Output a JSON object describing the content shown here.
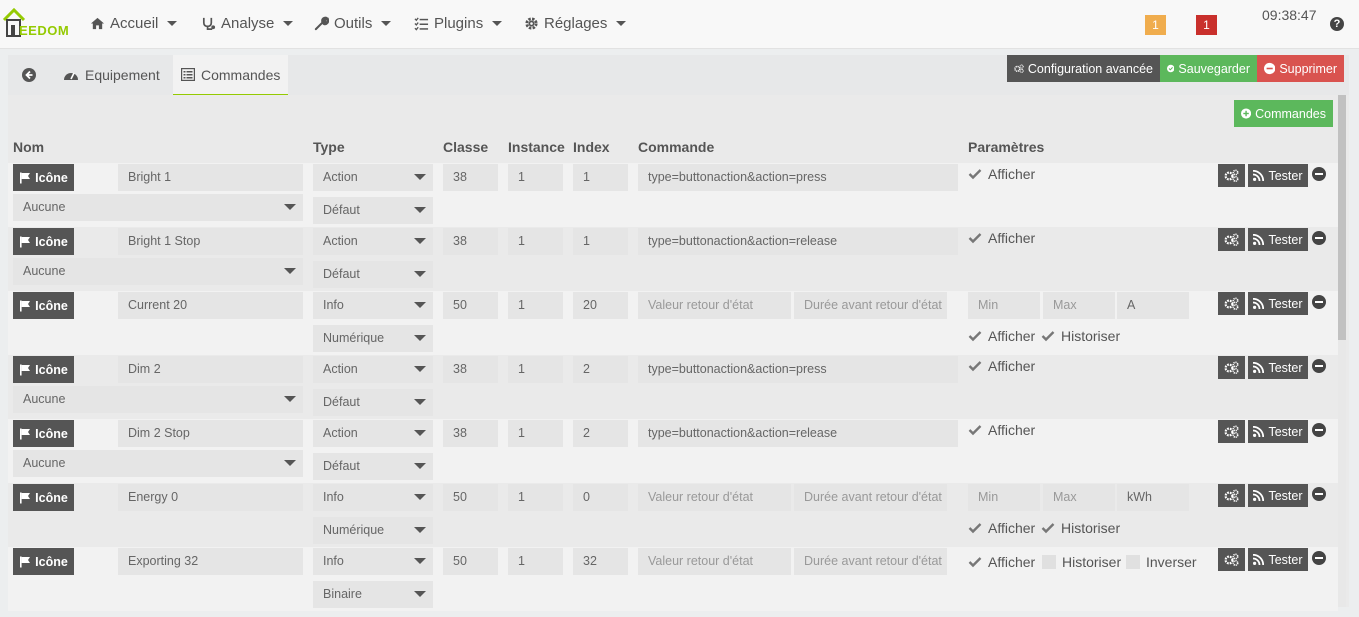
{
  "nav": {
    "logo_text": "EEDOM",
    "items": [
      {
        "label": "Accueil",
        "icon": "home-icon"
      },
      {
        "label": "Analyse",
        "icon": "stethoscope-icon"
      },
      {
        "label": "Outils",
        "icon": "wrench-icon"
      },
      {
        "label": "Plugins",
        "icon": "tasks-icon"
      },
      {
        "label": "Réglages",
        "icon": "cogs-icon"
      }
    ],
    "badge_warning": "1",
    "badge_danger": "1",
    "clock": "09:38:47",
    "help": "?"
  },
  "tabs": {
    "back_icon": "arrow-circle-left-icon",
    "equipement": "Equipement",
    "commandes": "Commandes"
  },
  "actions": {
    "config": "Configuration avancée",
    "save": "Sauvegarder",
    "delete": "Supprimer",
    "add_commands": "Commandes"
  },
  "table": {
    "headers": {
      "nom": "Nom",
      "type": "Type",
      "classe": "Classe",
      "instance": "Instance",
      "index": "Index",
      "commande": "Commande",
      "parametres": "Paramètres"
    },
    "icone_label": "Icône",
    "tester_label": "Tester",
    "afficher": "Afficher",
    "historiser": "Historiser",
    "inverser": "Inverser",
    "placeholders": {
      "valeur_retour": "Valeur retour d'état",
      "duree_retour": "Durée avant retour d'état",
      "min": "Min",
      "max": "Max"
    },
    "rows": [
      {
        "name": "Bright 1",
        "type": "Action",
        "subtype": "Défaut",
        "sub_select": "Aucune",
        "classe": "38",
        "instance": "1",
        "index": "1",
        "command": "type=buttonaction&action=press"
      },
      {
        "name": "Bright 1 Stop",
        "type": "Action",
        "subtype": "Défaut",
        "sub_select": "Aucune",
        "classe": "38",
        "instance": "1",
        "index": "1",
        "command": "type=buttonaction&action=release"
      },
      {
        "name": "Current 20",
        "type": "Info",
        "subtype": "Numérique",
        "classe": "50",
        "instance": "1",
        "index": "20",
        "unit": "A"
      },
      {
        "name": "Dim 2",
        "type": "Action",
        "subtype": "Défaut",
        "sub_select": "Aucune",
        "classe": "38",
        "instance": "1",
        "index": "2",
        "command": "type=buttonaction&action=press"
      },
      {
        "name": "Dim 2 Stop",
        "type": "Action",
        "subtype": "Défaut",
        "sub_select": "Aucune",
        "classe": "38",
        "instance": "1",
        "index": "2",
        "command": "type=buttonaction&action=release"
      },
      {
        "name": "Energy 0",
        "type": "Info",
        "subtype": "Numérique",
        "classe": "50",
        "instance": "1",
        "index": "0",
        "unit": "kWh"
      },
      {
        "name": "Exporting 32",
        "type": "Info",
        "subtype": "Binaire",
        "classe": "50",
        "instance": "1",
        "index": "32"
      }
    ]
  },
  "colors": {
    "accent": "#94ca02",
    "dark_button": "#555555",
    "success": "#5cb85c",
    "danger": "#d9534f",
    "warning_badge": "#f0ad4e",
    "danger_badge": "#c9302c"
  }
}
